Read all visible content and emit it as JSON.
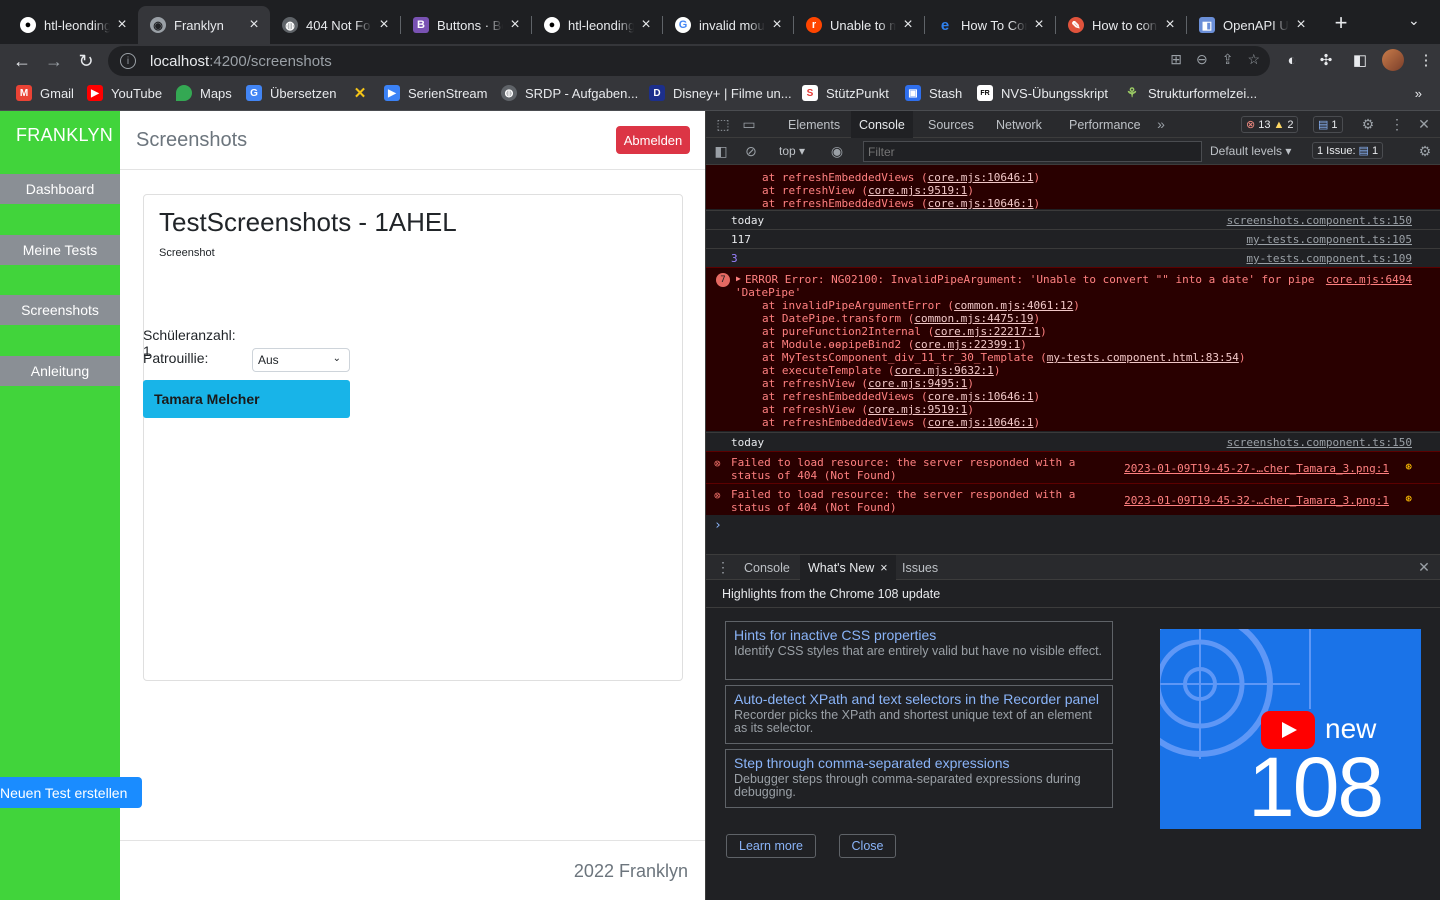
{
  "browser": {
    "tabs": [
      {
        "title": "htl-leonding",
        "icon": "github-icon",
        "color": "#ffffff"
      },
      {
        "title": "Franklyn",
        "icon": "franklyn-favicon",
        "color": "#9aa0a6"
      },
      {
        "title": "404 Not Fo",
        "icon": "globe-icon",
        "color": "#9aa0a6"
      },
      {
        "title": "Buttons · Bo",
        "icon": "bootstrap-icon",
        "color": "#7952b3"
      },
      {
        "title": "htl-leonding",
        "icon": "github-icon",
        "color": "#ffffff"
      },
      {
        "title": "invalid mou",
        "icon": "google-icon",
        "color": "#ffffff"
      },
      {
        "title": "Unable to m",
        "icon": "reddit-icon",
        "color": "#ff4500"
      },
      {
        "title": "How To Con",
        "icon": "e-icon",
        "color": "#2f80ed"
      },
      {
        "title": "How to con",
        "icon": "site-icon",
        "color": "#e0533c"
      },
      {
        "title": "OpenAPI UI",
        "icon": "openapi-icon",
        "color": "#6b8fd8"
      }
    ],
    "url_host": "localhost",
    "url_path": ":4200/screenshots",
    "bookmarks": [
      {
        "label": "Gmail",
        "icon": "gmail-icon",
        "color": "#ea4335"
      },
      {
        "label": "YouTube",
        "icon": "youtube-icon",
        "color": "#ff0000"
      },
      {
        "label": "Maps",
        "icon": "maps-icon",
        "color": "#34a853"
      },
      {
        "label": "Übersetzen",
        "icon": "translate-icon",
        "color": "#4285f4"
      },
      {
        "label": "",
        "icon": "x-icon",
        "color": "#f5c518"
      },
      {
        "label": "SerienStream",
        "icon": "serienstream-icon",
        "color": "#3b82f6"
      },
      {
        "label": "SRDP - Aufgaben...",
        "icon": "globe-icon",
        "color": "#9aa0a6"
      },
      {
        "label": "Disney+ | Filme un...",
        "icon": "disney-icon",
        "color": "#1c2f8c"
      },
      {
        "label": "StützPunkt",
        "icon": "stuetzpunkt-icon",
        "color": "#e53935"
      },
      {
        "label": "Stash",
        "icon": "stash-icon",
        "color": "#2f6fed"
      },
      {
        "label": "NVS-Übungsskript",
        "icon": "nvs-icon",
        "color": "#ffffff"
      },
      {
        "label": "Strukturformelzei...",
        "icon": "molecule-icon",
        "color": "#9ccc65"
      }
    ]
  },
  "app": {
    "brand": "FRANKLYN",
    "header_title": "Screenshots",
    "logout_label": "Abmelden",
    "nav": [
      "Dashboard",
      "Meine Tests",
      "Screenshots",
      "Anleitung"
    ],
    "new_test_label": "Neuen Test erstellen",
    "card_title": "TestScreenshots - 1AHEL",
    "screenshot_alt": "Screenshot",
    "student_count": "Schüleranzahl: 1",
    "patrol_label": "Patrouillie:",
    "patrol_value": "Aus",
    "student_name": "Tamara Melcher",
    "footer": "2022 Franklyn",
    "colors": {
      "sidebar": "#41d43b",
      "logout": "#dc3545",
      "student": "#18b4e8",
      "new_test": "#1a8cff"
    }
  },
  "devtools": {
    "tabs": [
      "Elements",
      "Console",
      "Sources",
      "Network",
      "Performance"
    ],
    "active_tab": "Console",
    "error_count": "13",
    "warning_count": "2",
    "info_count": "1",
    "context": "top",
    "filter_placeholder": "Filter",
    "levels": "Default levels",
    "issues": "1 Issue:",
    "issues_count": "1",
    "console": {
      "top_stack": [
        {
          "fn": "at refreshEmbeddedViews",
          "src": "core.mjs:10646:1"
        },
        {
          "fn": "at refreshView",
          "src": "core.mjs:9519:1"
        },
        {
          "fn": "at refreshEmbeddedViews",
          "src": "core.mjs:10646:1"
        }
      ],
      "logs": [
        {
          "text": "today",
          "src": "screenshots.component.ts:150"
        },
        {
          "text": "117",
          "src": "my-tests.component.ts:105"
        },
        {
          "text": "3",
          "src": "my-tests.component.ts:109"
        }
      ],
      "error_repeat": "7",
      "error_line1": "ERROR Error: NG02100: InvalidPipeArgument: 'Unable to convert \"\" into a date' for pipe",
      "error_line2": "'DatePipe'",
      "error_src": "core.mjs:6494",
      "error_stack": [
        {
          "fn": "at invalidPipeArgumentError",
          "src": "common.mjs:4061:12"
        },
        {
          "fn": "at DatePipe.transform",
          "src": "common.mjs:4475:19"
        },
        {
          "fn": "at pureFunction2Internal",
          "src": "core.mjs:22217:1"
        },
        {
          "fn": "at Module.ɵɵpipeBind2",
          "src": "core.mjs:22399:1"
        },
        {
          "fn": "at MyTestsComponent_div_11_tr_30_Template",
          "src": "my-tests.component.html:83:54"
        },
        {
          "fn": "at executeTemplate",
          "src": "core.mjs:9632:1"
        },
        {
          "fn": "at refreshView",
          "src": "core.mjs:9495:1"
        },
        {
          "fn": "at refreshEmbeddedViews",
          "src": "core.mjs:10646:1"
        },
        {
          "fn": "at refreshView",
          "src": "core.mjs:9519:1"
        },
        {
          "fn": "at refreshEmbeddedViews",
          "src": "core.mjs:10646:1"
        }
      ],
      "log_today": "today",
      "log_today_src": "screenshots.component.ts:150",
      "fail1_line1": "Failed to load resource: the server responded with a",
      "fail1_line2": "status of 404 (Not Found)",
      "fail1_src": "2023-01-09T19-45-27-…cher_Tamara_3.png:1",
      "fail2_line1": "Failed to load resource: the server responded with a",
      "fail2_line2": "status of 404 (Not Found)",
      "fail2_src": "2023-01-09T19-45-32-…cher_Tamara_3.png:1",
      "prompt": "›"
    },
    "drawer": {
      "tabs": [
        "Console",
        "What's New",
        "Issues"
      ],
      "headline": "Highlights from the Chrome 108 update",
      "cards": [
        {
          "title": "Hints for inactive CSS properties",
          "desc": "Identify CSS styles that are entirely valid but have no visible effect."
        },
        {
          "title": "Auto-detect XPath and text selectors in the Recorder panel",
          "desc": "Recorder picks the XPath and shortest unique text of an element as its selector."
        },
        {
          "title": "Step through comma-separated expressions",
          "desc": "Debugger steps through comma-separated expressions during debugging."
        }
      ],
      "promo_new": "new",
      "promo_version": "108",
      "learn_more": "Learn more",
      "close": "Close"
    }
  }
}
